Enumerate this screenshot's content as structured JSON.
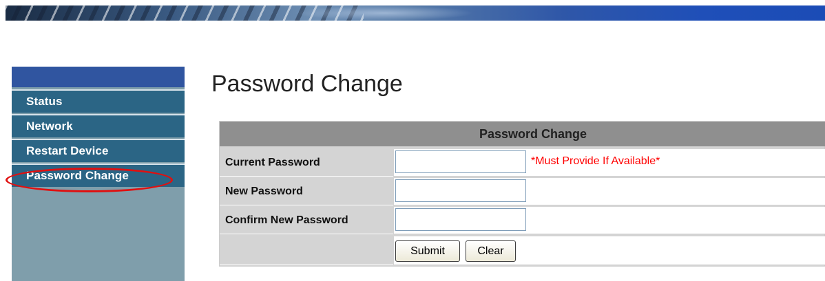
{
  "nav": {
    "items": [
      {
        "label": "Status"
      },
      {
        "label": "Network"
      },
      {
        "label": "Restart Device"
      },
      {
        "label": "Password Change"
      }
    ],
    "selected": "Password Change",
    "annotation_color": "#e01010"
  },
  "page": {
    "title": "Password Change"
  },
  "form": {
    "header": "Password Change",
    "fields": [
      {
        "label": "Current Password",
        "value": "",
        "note": "*Must Provide If Available*"
      },
      {
        "label": "New Password",
        "value": ""
      },
      {
        "label": "Confirm New Password",
        "value": ""
      }
    ],
    "submit_label": "Submit",
    "clear_label": "Clear"
  },
  "colors": {
    "sidebar_bg": "#7f9eab",
    "nav_item_bg": "#2b6585",
    "nav_top_bar": "#3055a0",
    "table_header_bg": "#8f8f8f",
    "label_cell_bg": "#d4d4d4",
    "note_color": "#ff0000"
  }
}
